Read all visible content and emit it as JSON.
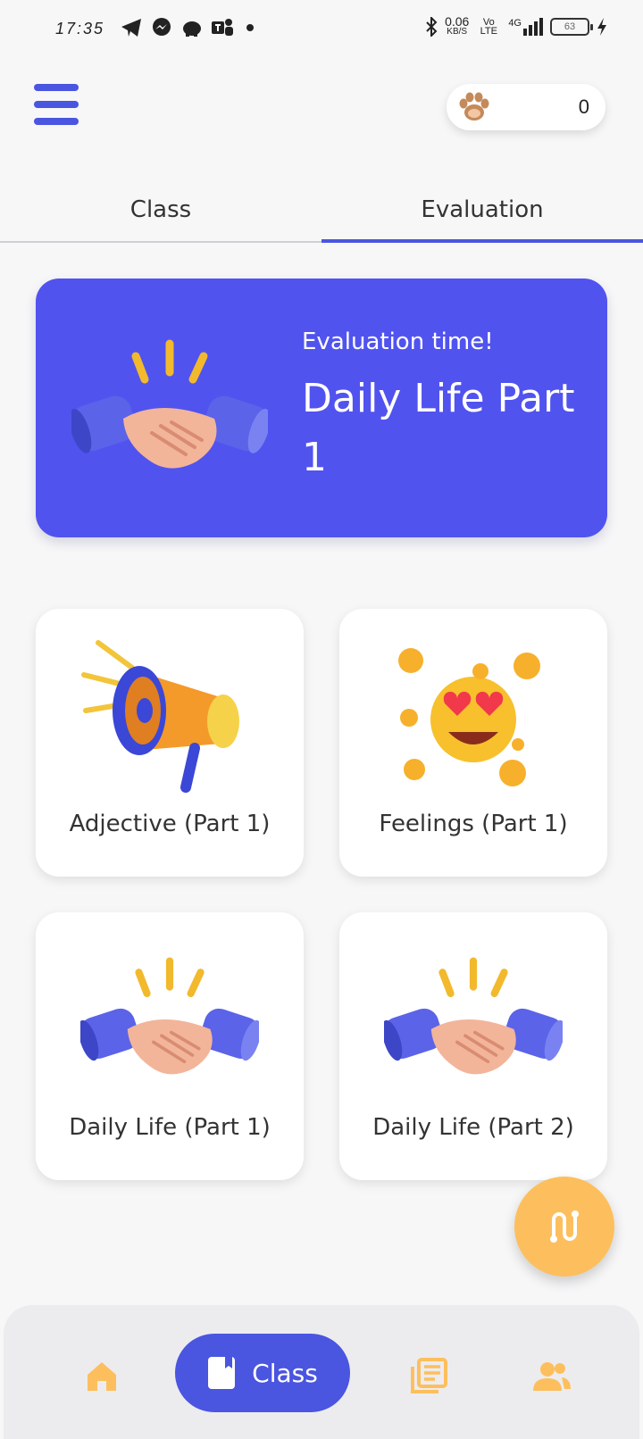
{
  "status_bar": {
    "time": "17:35",
    "speed_value": "0.06",
    "speed_unit": "KB/S",
    "volte_top": "Vo",
    "volte_bottom": "LTE",
    "network": "4G",
    "battery": "63",
    "left_icons": [
      "telegram-icon",
      "messenger-icon",
      "piggy-bank-icon",
      "teams-icon"
    ]
  },
  "header": {
    "score": "0"
  },
  "tabs": [
    {
      "label": "Class",
      "active": false
    },
    {
      "label": "Evaluation",
      "active": true
    }
  ],
  "hero": {
    "subtitle": "Evaluation time!",
    "title": "Daily Life Part 1",
    "icon": "handshake-icon"
  },
  "cards": [
    {
      "label": "Adjective (Part 1)",
      "icon": "megaphone-icon"
    },
    {
      "label": "Feelings (Part 1)",
      "icon": "heart-eyes-emoji-icon"
    },
    {
      "label": "Daily Life (Part 1)",
      "icon": "handshake-icon"
    },
    {
      "label": "Daily Life (Part 2)",
      "icon": "handshake-icon"
    }
  ],
  "bottom_nav": {
    "home_icon": "home-icon",
    "class_label": "Class",
    "lessons_icon": "lessons-icon",
    "friends_icon": "friends-icon"
  },
  "colors": {
    "primary": "#4a55e0",
    "hero_bg": "#5153ef",
    "accent": "#fdbf5d",
    "background": "#f7f7f8"
  }
}
